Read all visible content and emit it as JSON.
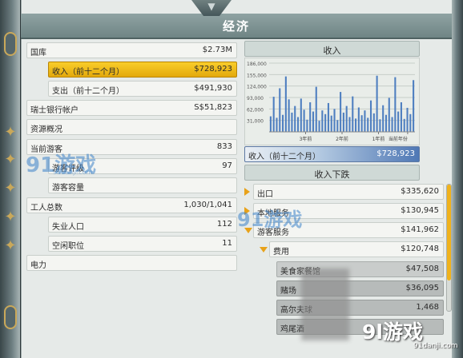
{
  "window": {
    "title": "经济"
  },
  "left_rows": [
    {
      "label": "国库",
      "value": "$2.73M",
      "state": "normal"
    },
    {
      "label": "收入（前十二个月）",
      "value": "$728,923",
      "state": "selected"
    },
    {
      "label": "支出（前十二个月）",
      "value": "$491,930",
      "state": "normal"
    },
    {
      "label": "瑞士银行帐户",
      "value": "S$51,823",
      "state": "normal"
    },
    {
      "label": "资源概况",
      "value": "",
      "state": "normal"
    },
    {
      "label": "当前游客",
      "value": "833",
      "state": "normal"
    },
    {
      "label": "游客评级",
      "value": "97",
      "state": "normal"
    },
    {
      "label": "游客容量",
      "value": "",
      "state": "normal"
    },
    {
      "label": "工人总数",
      "value": "1,030/1,041",
      "state": "normal"
    },
    {
      "label": "失业人口",
      "value": "112",
      "state": "normal"
    },
    {
      "label": "空闲职位",
      "value": "11",
      "state": "normal"
    },
    {
      "label": "电力",
      "value": "",
      "state": "normal"
    }
  ],
  "income_panel": {
    "header": "收入",
    "total_label": "收入（前十二个月）",
    "total_value": "$728,923"
  },
  "breakdown_panel": {
    "header": "收入下跌",
    "rows": [
      {
        "label": "出口",
        "value": "$335,620",
        "arrow": "right"
      },
      {
        "label": "本地服务",
        "value": "$130,945",
        "arrow": "right"
      },
      {
        "label": "游客服务",
        "value": "$141,962",
        "arrow": "down"
      },
      {
        "label": "费用",
        "value": "$120,748",
        "arrow": "down"
      },
      {
        "label": "美食家餐馆",
        "value": "$47,508",
        "arrow": ""
      },
      {
        "label": "赌场",
        "value": "$36,095",
        "arrow": ""
      },
      {
        "label": "高尔夫球",
        "value": "1,468",
        "arrow": ""
      },
      {
        "label": "鸡尾酒",
        "value": "",
        "arrow": ""
      }
    ]
  },
  "chart_data": {
    "type": "bar",
    "title": "",
    "xlabel": "",
    "ylabel": "",
    "y_ticks": [
      "186,000",
      "155,000",
      "124,000",
      "93,000",
      "62,000",
      "31,000"
    ],
    "ylim": [
      0,
      186000
    ],
    "x_tick_labels": [
      "3年前",
      "2年前",
      "1年前",
      "当前年份"
    ],
    "values": [
      42000,
      95000,
      38000,
      118000,
      46000,
      150000,
      88000,
      52000,
      70000,
      40000,
      90000,
      60000,
      33000,
      80000,
      55000,
      122000,
      30000,
      58000,
      48000,
      78000,
      44000,
      62000,
      32000,
      108000,
      52000,
      70000,
      40000,
      96000,
      36000,
      66000,
      45000,
      58000,
      38000,
      85000,
      50000,
      152000,
      34000,
      72000,
      46000,
      92000,
      40000,
      148000,
      55000,
      80000,
      35000,
      65000,
      48000,
      140000
    ],
    "bar_color": "#4f7fc0",
    "grid": true,
    "legend": "none"
  },
  "watermarks": {
    "main_1": "91游戏",
    "sub_1": "91danji.com",
    "main_2": "91游戏",
    "brand_main": "9l游戏",
    "brand_url": "91danji.com"
  },
  "icons": {
    "rail_ornament": "star-ornament-icon",
    "expand_arrow": "triangle-right-icon",
    "collapse_arrow": "triangle-down-icon",
    "notch": "chevron-down-icon"
  },
  "colors": {
    "selected_row": "#f2be1a",
    "bar": "#4f7fc0",
    "arrow": "#e8a21a"
  }
}
